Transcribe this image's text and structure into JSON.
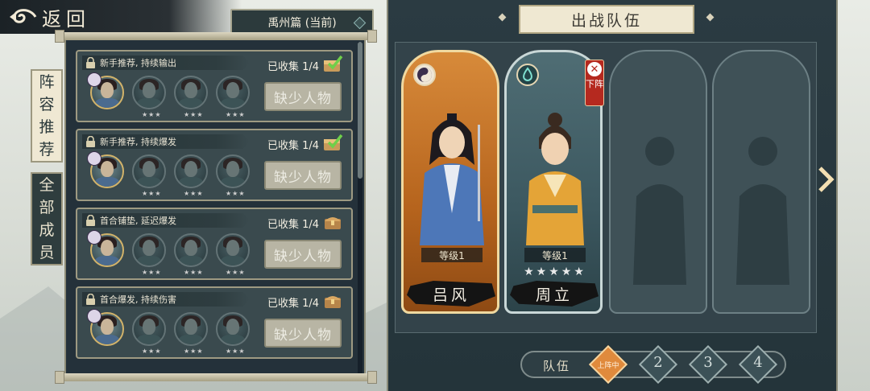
{
  "header": {
    "back_label": "返回",
    "chapter": "禹州篇 (当前)"
  },
  "tabs": [
    {
      "label": "阵容推荐",
      "chars": [
        "阵",
        "容",
        "推",
        "荐"
      ],
      "active": true
    },
    {
      "label": "全部成员",
      "chars": [
        "全",
        "部",
        "成",
        "员"
      ],
      "active": false
    }
  ],
  "teams": [
    {
      "title": "新手推荐, 持续输出",
      "collected": "已收集 1/4",
      "button": "缺少人物",
      "reward": "claimed"
    },
    {
      "title": "新手推荐, 持续爆发",
      "collected": "已收集 1/4",
      "button": "缺少人物",
      "reward": "claimed"
    },
    {
      "title": "首合铺垫, 延迟爆发",
      "collected": "已收集 1/4",
      "button": "缺少人物",
      "reward": "chest"
    },
    {
      "title": "首合爆发, 持续伤害",
      "collected": "已收集 1/4",
      "button": "缺少人物",
      "reward": "chest"
    }
  ],
  "battle": {
    "title": "出战队伍",
    "heroes": [
      {
        "name": "吕风",
        "level": "等级1",
        "stars": "",
        "element": "yin-yang",
        "frame": "gold"
      },
      {
        "name": "周立",
        "level": "等级1",
        "stars": "★★★★★",
        "element": "water",
        "frame": "silver",
        "remove_label": "下阵"
      }
    ],
    "empty_slots": 2
  },
  "squad": {
    "label": "队伍",
    "options": [
      "1",
      "2",
      "3",
      "4"
    ],
    "active": "1",
    "active_badge": "上阵中"
  },
  "colors": {
    "accent_orange": "#e08a3c",
    "panel_dark": "#24313a",
    "parchment": "#efe8d2",
    "remove_red": "#b5291f"
  }
}
